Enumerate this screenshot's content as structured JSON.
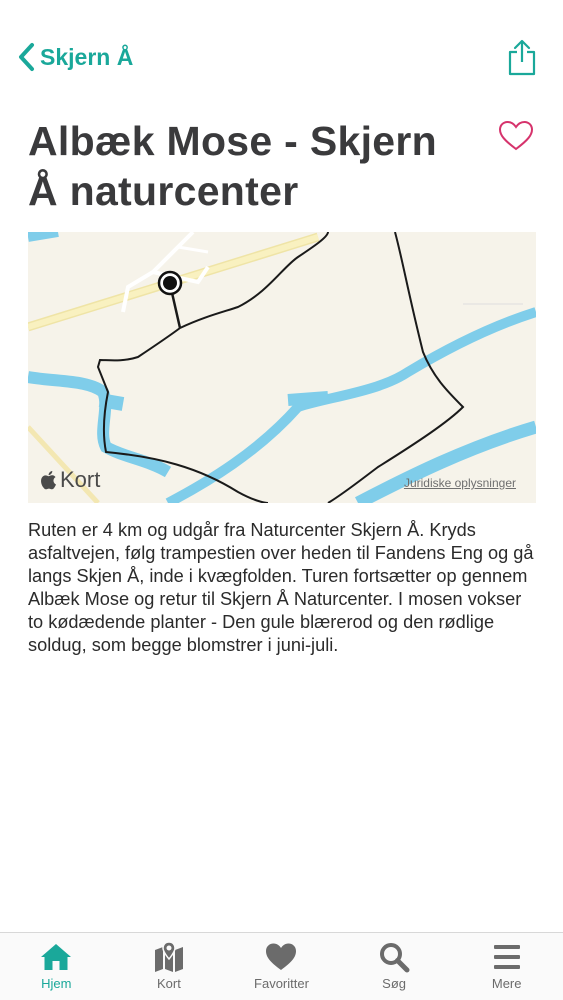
{
  "nav": {
    "back_label": "Skjern Å",
    "back_icon": "chevron-left-icon",
    "share_icon": "share-icon"
  },
  "title": "Albæk Mose - Skjern Å naturcenter",
  "favorite_icon": "heart-outline-icon",
  "map": {
    "logo_text": "Kort",
    "legal_link": "Juridiske oplysninger"
  },
  "description": "Ruten er 4 km og udgår fra Naturcenter Skjern Å. Kryds asfaltvejen, følg trampestien over heden til Fandens Eng og gå langs Skjen Å, inde i kvægfolden. Turen fortsætter op gennem Albæk Mose og retur til Skjern Å Naturcenter. I mosen vokser to kødædende planter - Den gule blærerod og den rødlige soldug, som begge blomstrer i juni-juli.",
  "tabs": [
    {
      "label": "Hjem",
      "icon": "home-icon",
      "active": true
    },
    {
      "label": "Kort",
      "icon": "map-icon",
      "active": false
    },
    {
      "label": "Favoritter",
      "icon": "heart-icon",
      "active": false
    },
    {
      "label": "Søg",
      "icon": "search-icon",
      "active": false
    },
    {
      "label": "Mere",
      "icon": "menu-icon",
      "active": false
    }
  ],
  "colors": {
    "accent": "#1aa89a",
    "favorite": "#d6336c",
    "water": "#7fcdea",
    "road": "#f7eeb0",
    "land": "#f6f3ea",
    "route": "#1a1a1a"
  }
}
